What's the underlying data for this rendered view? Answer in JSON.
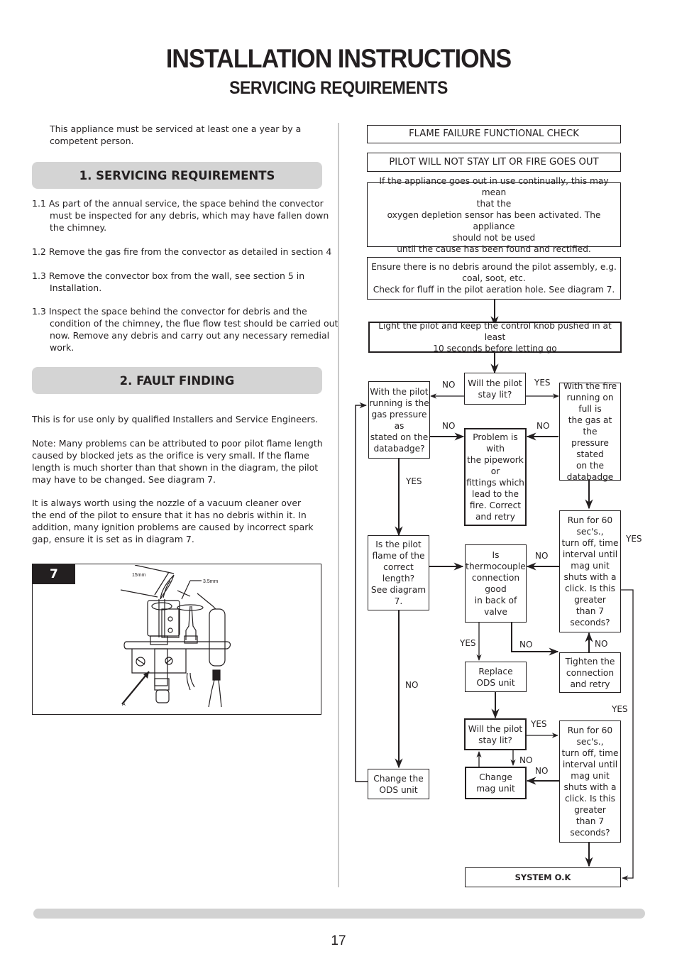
{
  "header": {
    "title": "INSTALLATION INSTRUCTIONS",
    "subtitle": "SERVICING REQUIREMENTS"
  },
  "left": {
    "intro": "This appliance must be serviced at least one a year by a competent person.",
    "section1": {
      "heading": "1. SERVICING REQUIREMENTS",
      "items": [
        "1.1 As part of the annual service, the space behind the convector must be inspected for any debris, which may have fallen down the chimney.",
        "1.2 Remove the gas fire from the convector as detailed in section 4",
        "1.3 Remove the convector box from the wall, see section 5 in Installation.",
        "1.3 Inspect the space behind the convector for debris and the condition of the chimney, the flue flow test should be carried out now. Remove any debris and carry out any necessary remedial work."
      ]
    },
    "section2": {
      "heading": "2. FAULT FINDING",
      "paragraphs": [
        "This is for use only by qualified Installers and Service Engineers.",
        "Note: Many problems can be attributed to poor pilot flame length caused by blocked jets as the orifice is very small. If the flame length is much shorter than that shown in the diagram, the pilot may have to be changed. See diagram 7.",
        "It is always worth using the nozzle of a vacuum cleaner over the end of the pilot to ensure that it has no debris within it. In addition, many ignition problems are caused by incorrect spark gap, ensure it is set as in diagram 7."
      ]
    },
    "diagram": {
      "number": "7",
      "label_flame": "15mm",
      "label_gap": "3.5mm",
      "label_a": "A"
    }
  },
  "flowchart": {
    "title": "FLAME FAILURE FUNCTIONAL CHECK",
    "problem": "PILOT WILL NOT STAY LIT OR FIRE GOES OUT",
    "warning": "If the appliance goes out in use continually, this may mean\nthat the\noxygen depletion sensor has been activated.  The appliance\nshould not be used\nuntil the cause has been found and rectified.",
    "debris_check": "Ensure there is no debris around the pilot assembly, e.g.\ncoal, soot, etc.\nCheck for fluff in the pilot aeration hole. See diagram 7.",
    "light_pilot": "Light the pilot and keep the control knob pushed in at least\n10 seconds before letting go",
    "pilot_stay_lit_1": "Will the pilot\nstay lit?",
    "gas_pressure_pilot": "With the pilot\nrunning is the\ngas pressure\nas\nstated on the\ndatabadge?",
    "gas_pressure_fire": "With the fire\nrunning on\nfull is\nthe gas at the\npressure\nstated\non the\ndatabadge",
    "pipework_problem": "Problem is\nwith\nthe pipework\nor\nfittings which\nlead to the\nfire. Correct\nand retry",
    "run_60_1": "Run for 60\nsec's.,\nturn off, time\ninterval until\nmag unit\nshuts with a\nclick. Is this\ngreater\n than 7\nseconds?",
    "flame_length": "Is the pilot\nflame of the\ncorrect\nlength?\nSee diagram\n7.",
    "thermocouple": "Is\nthermocouple\nconnection\ngood\nin back of\nvalve",
    "replace_ods": "Replace\nODS unit",
    "tighten": "Tighten the\nconnection\nand retry",
    "pilot_stay_lit_2": "Will the pilot\nstay lit?",
    "change_mag": "Change\nmag unit",
    "run_60_2": "Run for 60\nsec's.,\nturn off, time\ninterval until\nmag unit\nshuts with a\nclick. Is this\ngreater\n than 7\nseconds?",
    "change_ods": "Change the\nODS unit",
    "system_ok": "SYSTEM O.K",
    "labels": {
      "no": "NO",
      "yes": "YES"
    }
  },
  "footer": {
    "page_number": "17"
  }
}
